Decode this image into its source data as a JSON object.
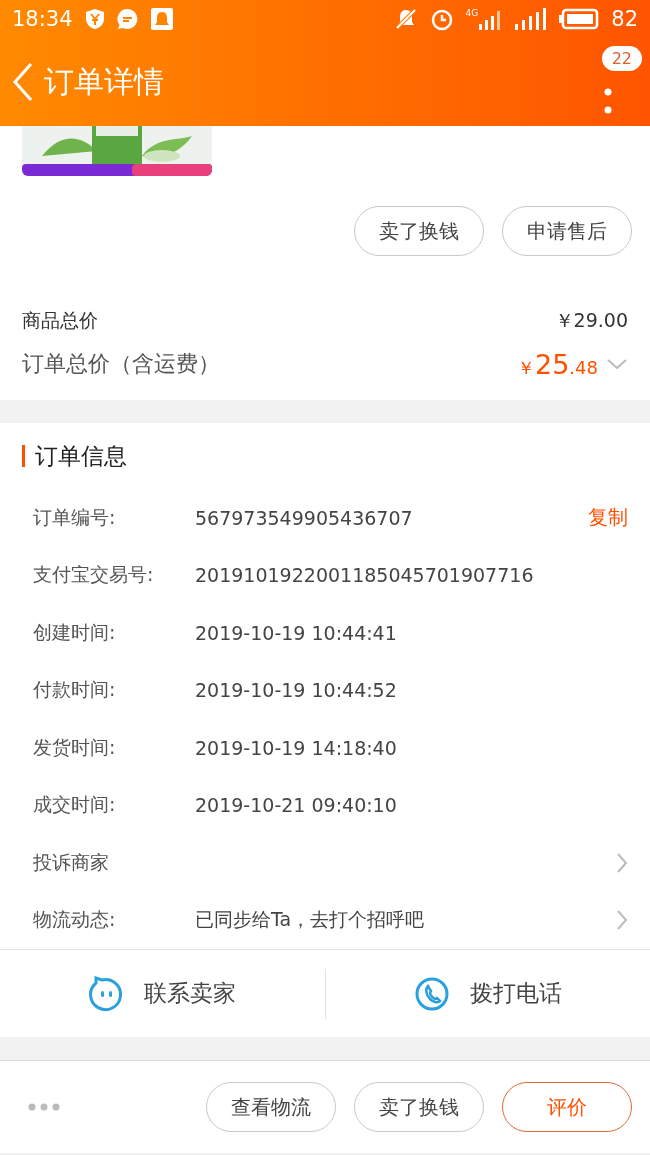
{
  "status_bar": {
    "time": "18:34",
    "network": "4G",
    "battery": "82"
  },
  "nav": {
    "title": "订单详情",
    "badge": "22"
  },
  "product": {
    "image": {
      "kind": "picture"
    },
    "actions": [
      "卖了换钱",
      "申请售后"
    ]
  },
  "totals": [
    {
      "kind": "plain",
      "label": "商品总价",
      "value": "￥29.00"
    },
    {
      "kind": "total",
      "label": "订单总价（含运费）",
      "currency": "￥",
      "integer": "25",
      "decimal": ".48"
    }
  ],
  "order_info": {
    "title": "订单信息",
    "rows": [
      {
        "label": "订单编号:",
        "value": "567973549905436707",
        "action": "复制",
        "chevron": false
      },
      {
        "label": "支付宝交易号:",
        "value": "2019101922001185045701907716",
        "chevron": false
      },
      {
        "label": "创建时间:",
        "value": "2019-10-19 10:44:41",
        "chevron": false
      },
      {
        "label": "付款时间:",
        "value": "2019-10-19 10:44:52",
        "chevron": false
      },
      {
        "label": "发货时间:",
        "value": "2019-10-19 14:18:40",
        "chevron": false
      },
      {
        "label": "成交时间:",
        "value": "2019-10-21 09:40:10",
        "chevron": false
      },
      {
        "label": "投诉商家",
        "chevron": true
      },
      {
        "label": "物流动态:",
        "value": "已同步给Ta，去打个招呼吧",
        "chevron": true
      }
    ]
  },
  "contact": [
    {
      "kind": "chat",
      "label": "联系卖家"
    },
    {
      "kind": "phone",
      "label": "拨打电话"
    }
  ],
  "bottom_bar": {
    "buttons": [
      {
        "label": "查看物流",
        "primary": false
      },
      {
        "label": "卖了换钱",
        "primary": false
      },
      {
        "label": "评价",
        "primary": true
      }
    ]
  }
}
